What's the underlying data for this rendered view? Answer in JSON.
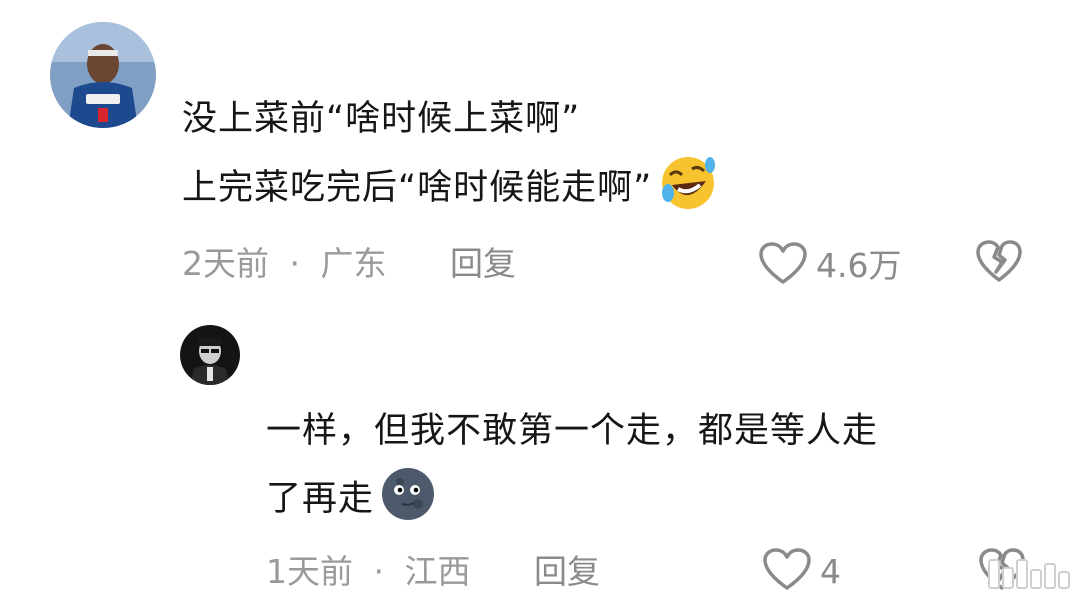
{
  "comment": {
    "line1": "没上菜前“啥时候上菜啊”",
    "line2": "上完菜吃完后“啥时候能走啊”",
    "emoji_icon": "rolling-on-floor-laughing-emoji",
    "time": "2天前",
    "location": "广东",
    "separator": "·",
    "reply_label": "回复",
    "like_count": "4.6万"
  },
  "reply": {
    "line1": "一样，但我不敢第一个走，都是等人走",
    "line2": "了再走",
    "emoji_icon": "new-moon-face-emoji",
    "time": "1天前",
    "location": "江西",
    "separator": "·",
    "reply_label": "回复",
    "like_count": "4"
  },
  "colors": {
    "text": "#161616",
    "meta": "#9a9a9a",
    "icon": "#8a8a8a"
  }
}
